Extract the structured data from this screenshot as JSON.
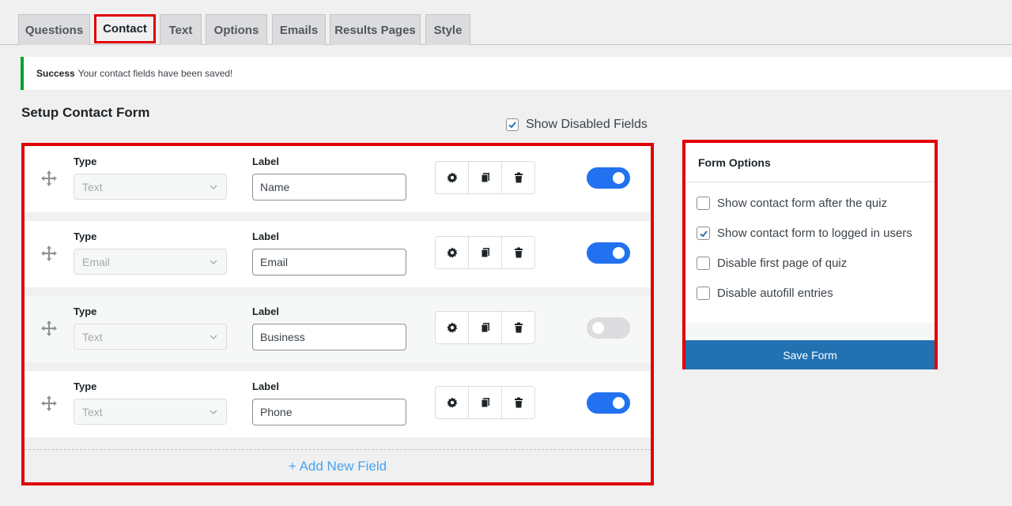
{
  "tabs": [
    {
      "label": "Questions",
      "active": false
    },
    {
      "label": "Contact",
      "active": true
    },
    {
      "label": "Text",
      "active": false
    },
    {
      "label": "Options",
      "active": false
    },
    {
      "label": "Emails",
      "active": false
    },
    {
      "label": "Results Pages",
      "active": false
    },
    {
      "label": "Style",
      "active": false
    }
  ],
  "notice": {
    "strong": "Success",
    "message": "Your contact fields have been saved!"
  },
  "section_title": "Setup Contact Form",
  "show_disabled": {
    "label": "Show Disabled Fields",
    "checked": true
  },
  "field_labels": {
    "type": "Type",
    "label": "Label"
  },
  "fields": [
    {
      "type": "Text",
      "label": "Name",
      "enabled": true
    },
    {
      "type": "Email",
      "label": "Email",
      "enabled": true
    },
    {
      "type": "Text",
      "label": "Business",
      "enabled": false
    },
    {
      "type": "Text",
      "label": "Phone",
      "enabled": true
    }
  ],
  "add_field": "+ Add New Field",
  "form_options": {
    "title": "Form Options",
    "items": [
      {
        "label": "Show contact form after the quiz",
        "checked": false
      },
      {
        "label": "Show contact form to logged in users",
        "checked": true
      },
      {
        "label": "Disable first page of quiz",
        "checked": false
      },
      {
        "label": "Disable autofill entries",
        "checked": false
      }
    ],
    "save_label": "Save Form"
  },
  "colors": {
    "accent": "#2271b1",
    "toggle_on": "#2271f0",
    "highlight": "#e00000",
    "success": "#00a32a"
  }
}
